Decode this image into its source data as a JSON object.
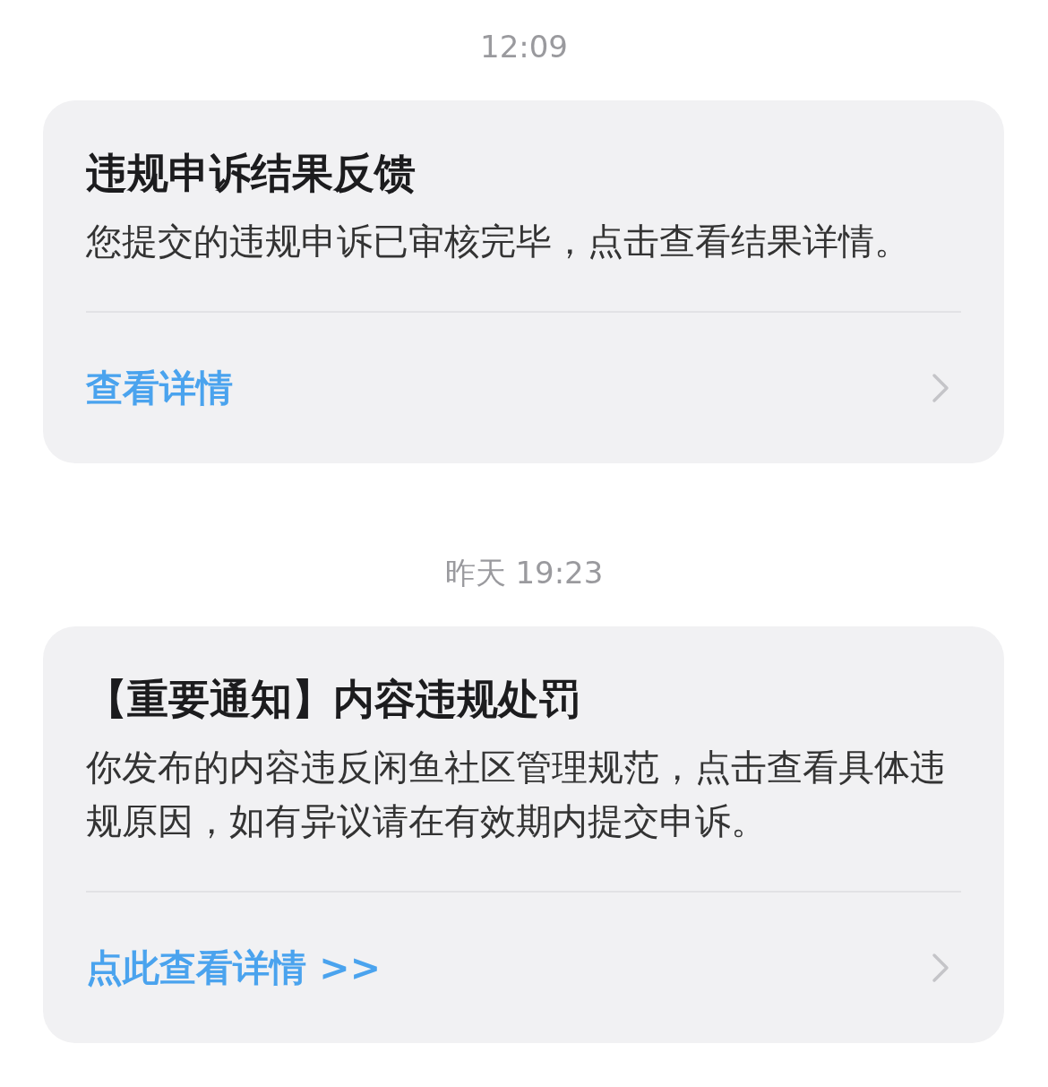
{
  "messages": [
    {
      "time": "12:09",
      "title": "违规申诉结果反馈",
      "body": "您提交的违规申诉已审核完毕，点击查看结果详情。",
      "link": "查看详情"
    },
    {
      "time": "昨天 19:23",
      "title": "【重要通知】内容违规处罚",
      "body": "你发布的内容违反闲鱼社区管理规范，点击查看具体违规原因，如有异议请在有效期内提交申诉。",
      "link": "点此查看详情 >>"
    }
  ]
}
